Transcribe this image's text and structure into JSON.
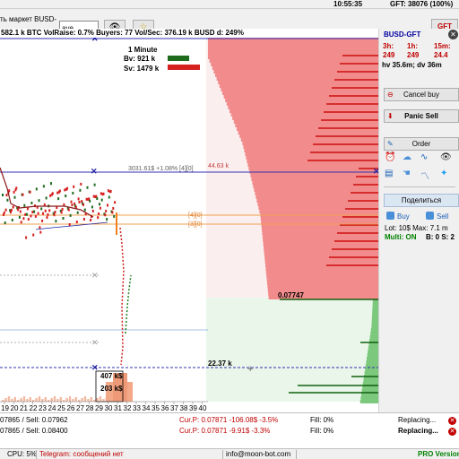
{
  "topbar": {
    "time": "10:55:35",
    "balance": "GFT: 38076  (100%)"
  },
  "toolbar": {
    "coin_label": "ть маркет BUSD-",
    "coin_input_value": "aye",
    "watch_icon": "eye-icon",
    "favorite_icon": "star-icon",
    "pair_button": "GFT"
  },
  "statusline": "582.1 k BTC  VolRaise: 0.7%  Buyers: 77   Vol/Sec: 376.19 k BUSD  d: 249%",
  "chart": {
    "timeframe": "1 Minute",
    "bv_label": "Bv: 921 k",
    "sv_label": "Sv: 1479 k",
    "buy_color": "#1e6b1e",
    "sell_color": "#d62020",
    "price_line_label": "3031.61$  +1.08%  [4][0]",
    "ask_volume_label": "44.63 k",
    "level_label_1": "[4][0]",
    "level_label_2": "[3][0]",
    "bid_price_label": "0.07747",
    "bid_volume_label": "22.37 k",
    "vol_label_1": "407 k$",
    "vol_label_2": "203 k$",
    "x_ticks": [
      "19",
      "20",
      "21",
      "22",
      "23",
      "24",
      "25",
      "26",
      "27",
      "28",
      "29",
      "30",
      "31",
      "32",
      "33",
      "34",
      "35",
      "36",
      "37",
      "38",
      "39",
      "40"
    ],
    "ask_color": "#f28b8b",
    "bid_color": "#7cc87c"
  },
  "right": {
    "pair": "BUSD-GFT",
    "close_icon": "close-icon",
    "stats": [
      {
        "h": "3h:",
        "v": "249"
      },
      {
        "h": "1h:",
        "v": "249"
      },
      {
        "h": "15m:",
        "v": "24.4"
      }
    ],
    "hv": "hv 35.6m; dv 36m",
    "cancel_buy": "Cancel buy",
    "panic_sell": "Panic Sell",
    "order": "Order",
    "share": "Поделиться",
    "buy": "Buy",
    "sell": "Sell",
    "lot": "Lot: 10$  Max: 7.1 m",
    "multi": "Multi: ON",
    "bs": "B: 0  S: 2"
  },
  "orders": [
    {
      "left": "07865 / Sell: 0.07962",
      "curp": "Cur.P: 0.07871  -106.08$  -3.5%",
      "fill": "Fill: 0%",
      "status": "Replacing..."
    },
    {
      "left": "07865 / Sell: 0.08400",
      "curp": "Cur.P: 0.07871  -9.91$  -3.3%",
      "fill": "Fill: 0%",
      "status": "Replacing..."
    }
  ],
  "bottom": {
    "cpu": "CPU: 5%",
    "telegram": "Telegram: сообщений нет",
    "email": "info@moon-bot.com",
    "version": "PRO Version"
  }
}
